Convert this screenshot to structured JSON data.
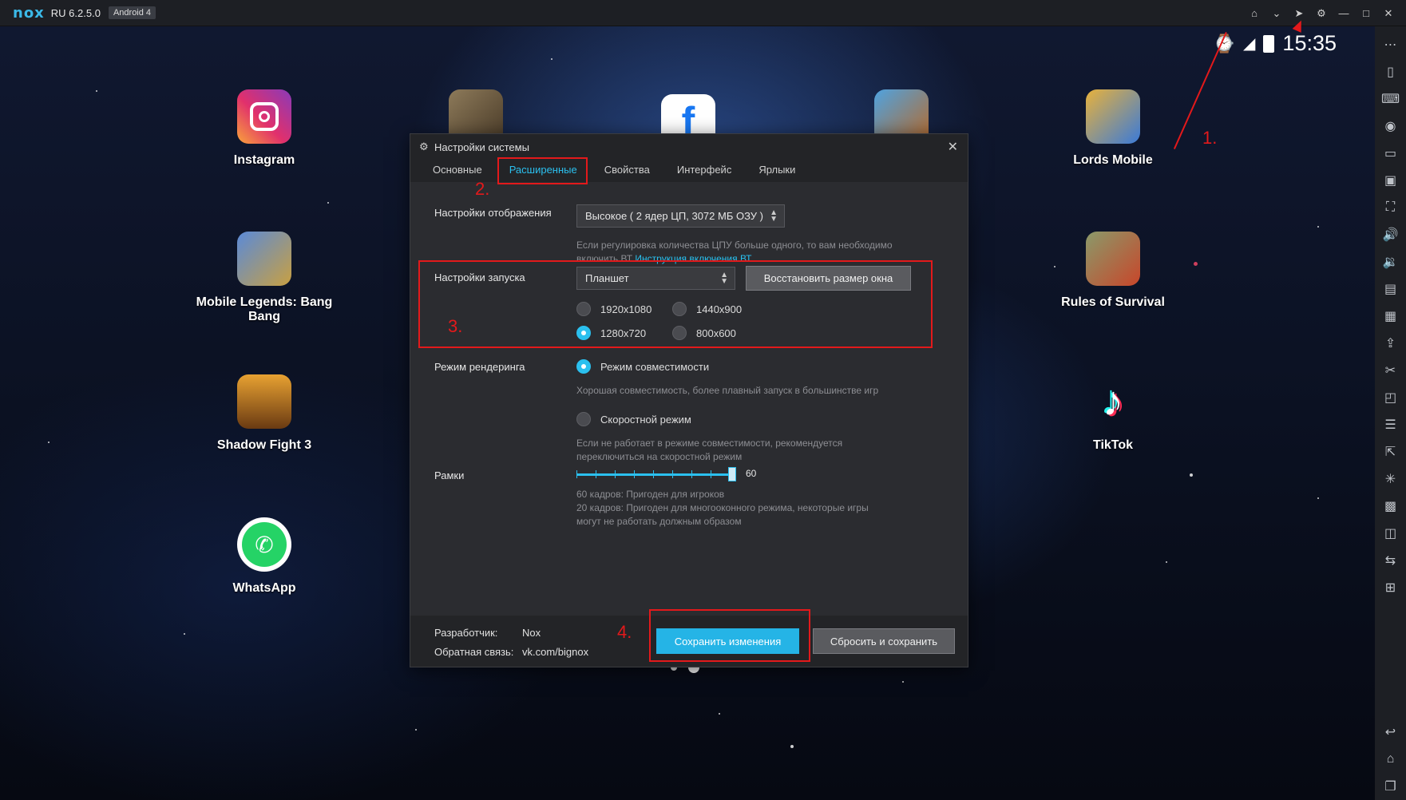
{
  "titlebar": {
    "logo": "nox",
    "version": "RU 6.2.5.0",
    "android": "Android 4",
    "controls": [
      "home-icon",
      "chevron-down-icon",
      "pin-icon",
      "gear-icon",
      "minimize-icon",
      "maximize-icon",
      "close-icon"
    ]
  },
  "status": {
    "clock": "15:35"
  },
  "apps": [
    {
      "name": "Instagram",
      "label": "Instagram"
    },
    {
      "name": "Lords Mobile",
      "label": "Lords Mobile"
    },
    {
      "name": "Mobile Legends",
      "label": "Mobile Legends: Bang Bang"
    },
    {
      "name": "Rules of Survival",
      "label": "Rules of Survival"
    },
    {
      "name": "Shadow Fight 3",
      "label": "Shadow Fight 3"
    },
    {
      "name": "TikTok",
      "label": "TikTok"
    },
    {
      "name": "WhatsApp",
      "label": "WhatsApp"
    }
  ],
  "dialog": {
    "title": "Настройки системы",
    "tabs": [
      "Основные",
      "Расширенные",
      "Свойства",
      "Интерфейс",
      "Ярлыки"
    ],
    "active_tab": "Расширенные",
    "display": {
      "label": "Настройки отображения",
      "value": "Высокое ( 2 ядер ЦП, 3072 МБ ОЗУ )",
      "hint": "Если регулировка количества ЦПУ больше одного, то вам необходимо",
      "hint2": "включить ВТ",
      "hint_link": "Инструкция включения ВТ"
    },
    "launch": {
      "label": "Настройки запуска",
      "value": "Планшет",
      "restore_button": "Восстановить размер окна",
      "resolutions": [
        "1920x1080",
        "1440x900",
        "1280x720",
        "800x600"
      ],
      "selected": "1280x720"
    },
    "render": {
      "label": "Режим рендеринга",
      "compat": "Режим совместимости",
      "compat_hint": "Хорошая совместимость, более плавный запуск в большинстве игр",
      "speed": "Скоростной режим",
      "speed_hint1": "Если не работает в режиме совместимости, рекомендуется",
      "speed_hint2": "переключиться на скоростной режим"
    },
    "frames": {
      "label": "Рамки",
      "value": "60",
      "hint1": "60 кадров: Пригоден для игроков",
      "hint2": "20 кадров: Пригоден для многооконного режима, некоторые игры",
      "hint3": "могут не работать должным образом"
    },
    "footer": {
      "dev_label": "Разработчик:",
      "dev_value": "Nox",
      "feedback_label": "Обратная связь:",
      "feedback_value": "vk.com/bignox",
      "save": "Сохранить изменения",
      "reset": "Сбросить и сохранить"
    }
  },
  "annotations": [
    "1.",
    "2.",
    "3.",
    "4."
  ],
  "colors": {
    "accent": "#2bc0ef",
    "annotation": "#e3191b",
    "dialog_bg": "#2b2c30"
  }
}
